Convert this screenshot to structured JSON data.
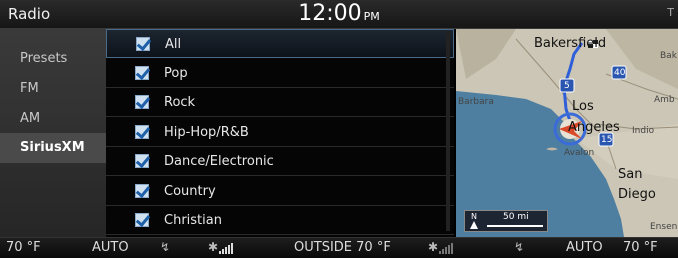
{
  "header": {
    "title": "Radio",
    "time": "12:00",
    "ampm": "PM"
  },
  "sidebar": {
    "items": [
      {
        "label": "Presets",
        "active": false
      },
      {
        "label": "FM",
        "active": false
      },
      {
        "label": "AM",
        "active": false
      },
      {
        "label": "SiriusXM",
        "active": true
      }
    ]
  },
  "genres": {
    "items": [
      {
        "label": "All",
        "checked": true,
        "selected": true
      },
      {
        "label": "Pop",
        "checked": true
      },
      {
        "label": "Rock",
        "checked": true
      },
      {
        "label": "Hip-Hop/R&B",
        "checked": true
      },
      {
        "label": "Dance/Electronic",
        "checked": true
      },
      {
        "label": "Country",
        "checked": true
      },
      {
        "label": "Christian",
        "checked": true
      }
    ]
  },
  "map": {
    "cities": {
      "bakersfield": "Bakersfield",
      "los": "Los",
      "angeles": "Angeles",
      "san": "San",
      "diego": "Diego",
      "barbara": "Barbara",
      "indio": "Indio",
      "avalon": "Avalon",
      "amb": "Amb",
      "bak": "Bak",
      "ensen": "Ensen"
    },
    "highways": [
      "5",
      "40",
      "15"
    ],
    "scale": {
      "north": "N",
      "distance": "50 mi"
    },
    "route_color": "#2f5fd8"
  },
  "climate": {
    "left_temp": "70 °F",
    "left_mode": "AUTO",
    "outside_label": "OUTSIDE",
    "outside_temp": "70 °F",
    "right_mode": "AUTO",
    "right_temp": "70 °F"
  }
}
